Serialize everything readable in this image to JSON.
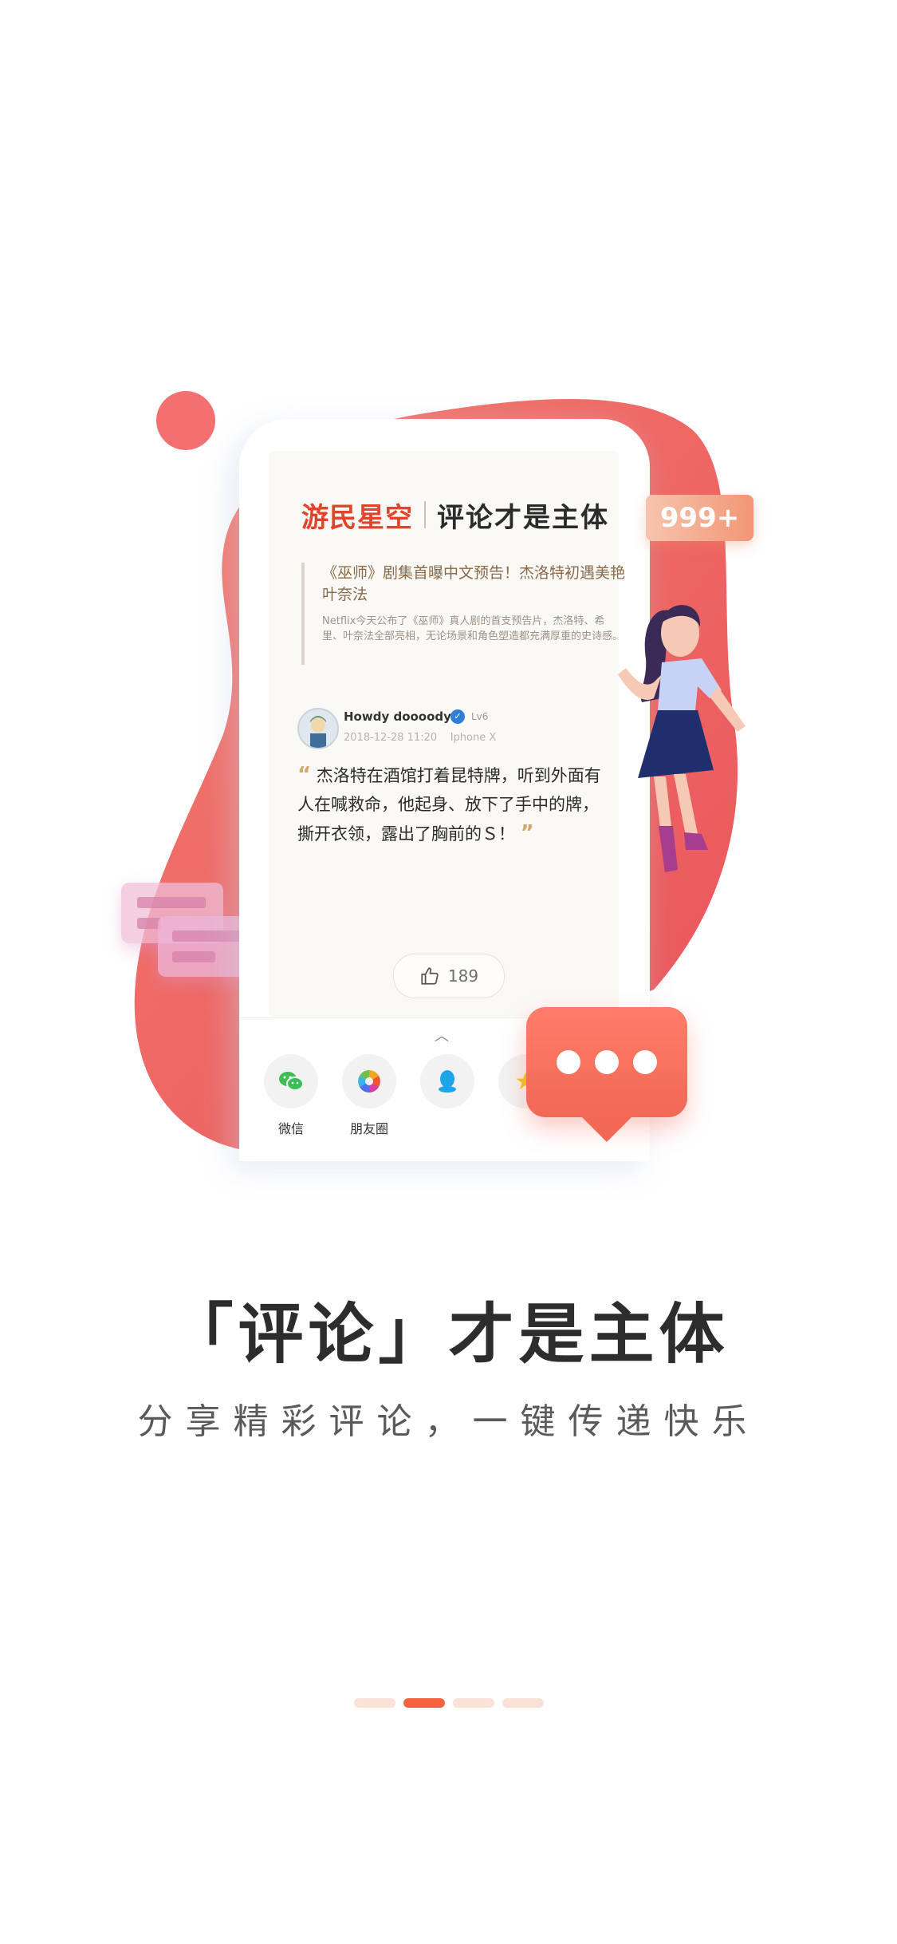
{
  "brand": {
    "name": "游民星空",
    "slogan": "评论才是主体"
  },
  "article": {
    "title": "《巫师》剧集首曝中文预告！杰洛特初遇美艳叶奈法",
    "excerpt": "Netflix今天公布了《巫师》真人剧的首支预告片，杰洛特、希里、叶奈法全部亮相，无论场景和角色塑造都充满厚重的史诗感。"
  },
  "comment": {
    "username": "Howdy doooody",
    "level": "Lv6",
    "timestamp": "2018-12-28 11:20",
    "device": "Iphone X",
    "open_quote": "“",
    "text": "杰洛特在酒馆打着昆特牌，听到外面有人在喊救命，他起身、放下了手中的牌，撕开衣领，露出了胸前的Ｓ！",
    "close_quote": "”",
    "likes": "189"
  },
  "share": {
    "items": [
      {
        "label": "微信",
        "icon": "wechat-icon"
      },
      {
        "label": "朋友圈",
        "icon": "moments-icon"
      },
      {
        "label": "",
        "icon": "qq-icon"
      },
      {
        "label": "",
        "icon": "star-icon"
      }
    ]
  },
  "badge": {
    "text": "999+"
  },
  "headline": "「评论」才是主体",
  "subheadline": "分享精彩评论，一键传递快乐",
  "pagination": {
    "total": 4,
    "active_index": 1
  },
  "colors": {
    "accent": "#f5623f",
    "blob": "#f26a6a",
    "bubble": "#f26855",
    "brand_red": "#e0452c"
  }
}
